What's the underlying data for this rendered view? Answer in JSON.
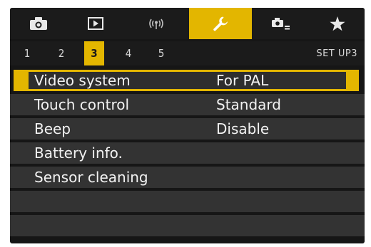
{
  "tabs": [
    {
      "icon": "camera-icon",
      "active": false
    },
    {
      "icon": "playback-icon",
      "active": false
    },
    {
      "icon": "wireless-icon",
      "active": false
    },
    {
      "icon": "wrench-icon",
      "active": true
    },
    {
      "icon": "custom-functions-icon",
      "active": false
    },
    {
      "icon": "star-icon",
      "active": false
    }
  ],
  "subpages": [
    "1",
    "2",
    "3",
    "4",
    "5"
  ],
  "active_subpage": "3",
  "page_code": "SET UP3",
  "menu": [
    {
      "label": "Video system",
      "value": "For PAL",
      "selected": true
    },
    {
      "label": "Touch control",
      "value": "Standard",
      "selected": false
    },
    {
      "label": "Beep",
      "value": "Disable",
      "selected": false
    },
    {
      "label": "Battery info.",
      "value": "",
      "selected": false
    },
    {
      "label": "Sensor cleaning",
      "value": "",
      "selected": false
    },
    {
      "label": "",
      "value": "",
      "selected": false
    },
    {
      "label": "",
      "value": "",
      "selected": false
    }
  ],
  "colors": {
    "accent": "#e3b600",
    "row_bg": "#333333",
    "screen_bg": "#161616",
    "text": "#f2f2f2"
  }
}
